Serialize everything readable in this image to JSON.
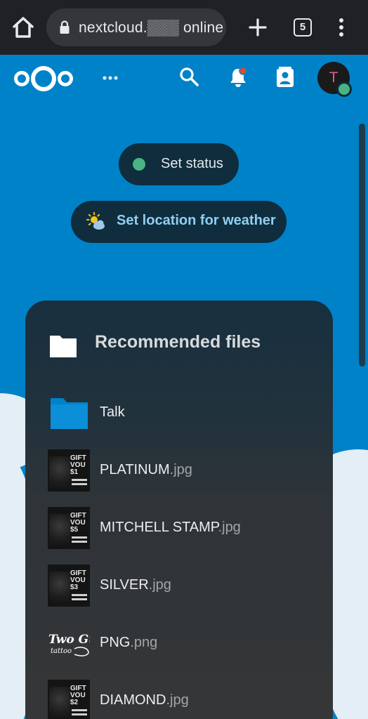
{
  "browser": {
    "url_text": "nextcloud.▒▒▒ online",
    "tab_count": "5"
  },
  "header": {
    "avatar_initial": "T"
  },
  "status": {
    "label": "Set status",
    "dot_color": "#49b382"
  },
  "weather": {
    "label": "Set location for weather",
    "icon": "partly-sunny-icon"
  },
  "recommended": {
    "title": "Recommended files",
    "files": [
      {
        "name": "Talk",
        "ext": "",
        "type": "folder"
      },
      {
        "name": "PLATINUM",
        "ext": ".jpg",
        "type": "image",
        "thumb_text": "GIFT VOU $1"
      },
      {
        "name": "MITCHELL STAMP",
        "ext": ".jpg",
        "type": "image",
        "thumb_text": "GIFT VOU $5"
      },
      {
        "name": "SILVER",
        "ext": ".jpg",
        "type": "image",
        "thumb_text": "GIFT VOU $3"
      },
      {
        "name": "PNG",
        "ext": ".png",
        "type": "image",
        "thumb_text": "Two Gun tattoo"
      },
      {
        "name": "DIAMOND",
        "ext": ".jpg",
        "type": "image",
        "thumb_text": "GIFT VOU $2"
      }
    ]
  },
  "colors": {
    "brand_blue": "#0082c9",
    "panel_dark": "#172f3f",
    "online_green": "#49b382",
    "notification_dot": "#e9482a"
  }
}
